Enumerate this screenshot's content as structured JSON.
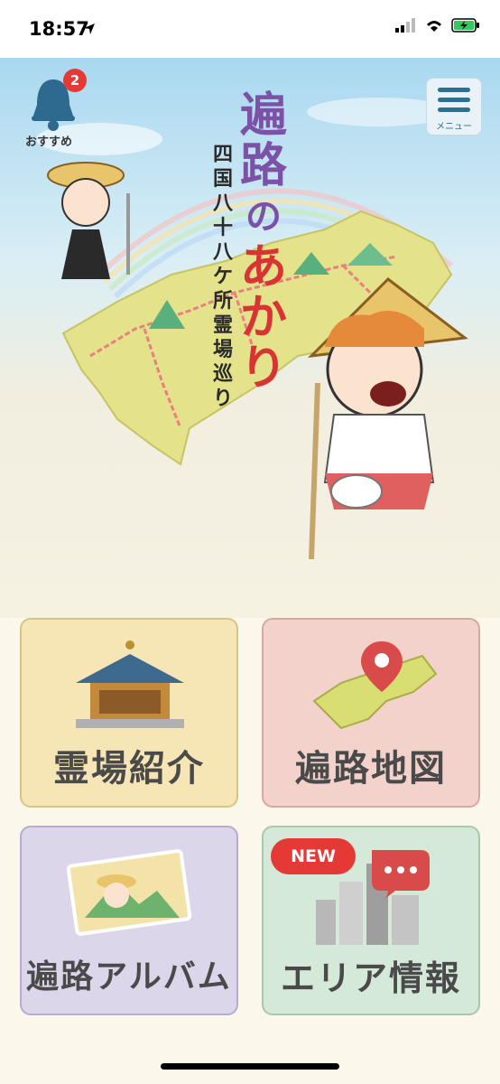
{
  "status": {
    "time": "18:57"
  },
  "header": {
    "bell_label": "おすすめ",
    "bell_badge": "2",
    "menu_label": "メニュー"
  },
  "logo": {
    "line1": [
      "遍",
      "路",
      "の",
      "あ",
      "か",
      "り"
    ],
    "subtitle": [
      "四",
      "国",
      "八",
      "十",
      "八",
      "ケ",
      "所",
      "霊",
      "場",
      "巡",
      "り"
    ]
  },
  "tiles": {
    "temple": {
      "label": "霊場紹介",
      "color": "#f7e6b5"
    },
    "map": {
      "label": "遍路地図",
      "color": "#f2d2ca"
    },
    "album": {
      "label": "遍路アルバム",
      "color": "#dcd6ea"
    },
    "area": {
      "label": "エリア情報",
      "color": "#d4e9d8",
      "new_badge": "NEW"
    }
  }
}
